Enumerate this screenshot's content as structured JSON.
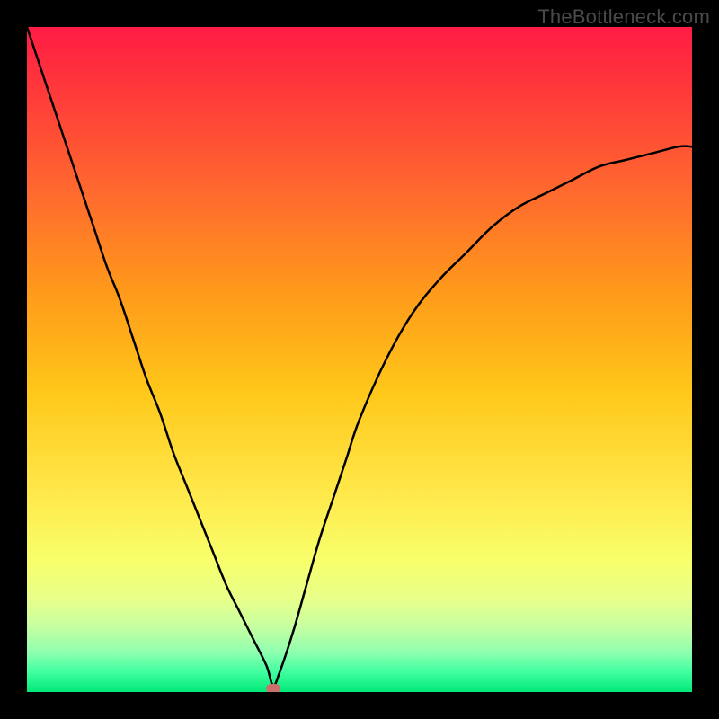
{
  "watermark": "TheBottleneck.com",
  "chart_data": {
    "type": "line",
    "title": "",
    "xlabel": "",
    "ylabel": "",
    "xlim": [
      0,
      100
    ],
    "ylim": [
      0,
      100
    ],
    "x": [
      0,
      2,
      4,
      6,
      8,
      10,
      12,
      14,
      16,
      18,
      20,
      22,
      24,
      26,
      28,
      30,
      32,
      34,
      36,
      37,
      38,
      40,
      42,
      44,
      46,
      48,
      50,
      54,
      58,
      62,
      66,
      70,
      74,
      78,
      82,
      86,
      90,
      94,
      98,
      100
    ],
    "values": [
      100,
      94,
      88,
      82,
      76,
      70,
      64,
      59,
      53,
      47,
      42,
      36,
      31,
      26,
      21,
      16,
      12,
      8,
      4,
      1,
      3,
      9,
      16,
      23,
      29,
      35,
      41,
      50,
      57,
      62,
      66,
      70,
      73,
      75,
      77,
      79,
      80,
      81,
      82,
      82
    ],
    "annotations": [
      {
        "type": "marker",
        "x": 37,
        "y": 0.5,
        "color": "#cc6f6a"
      }
    ],
    "background_gradient": {
      "top": "#ff1c44",
      "bottom": "#00e878"
    }
  }
}
